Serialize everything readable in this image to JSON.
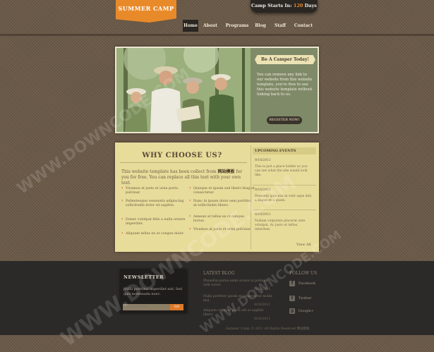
{
  "header": {
    "logo": "SUMMER CAMP",
    "countdown_prefix": "Camp Starts In:",
    "countdown_number": "120",
    "countdown_suffix": "Days"
  },
  "nav": {
    "items": [
      {
        "label": "Home",
        "active": true
      },
      {
        "label": "About",
        "active": false
      },
      {
        "label": "Programs",
        "active": false
      },
      {
        "label": "Blog",
        "active": false
      },
      {
        "label": "Staff",
        "active": false
      },
      {
        "label": "Contact",
        "active": false
      }
    ]
  },
  "hero": {
    "ribbon": "Be A Camper Today!",
    "description": "You can remove any link to our website from this website template, you're free to use this website template without linking back to us.",
    "button": "REGISTER NOW!"
  },
  "why": {
    "title": "WHY CHOOSE US?",
    "intro_before": "This website template has been collect from",
    "intro_link": "网站模板",
    "intro_after": "for you for free. You can replace all this text with your own text.",
    "bullets": [
      "Vivamus at justo et urna porta pulvinar.",
      "Pellentesque venenatis adipiscing sollicitudin dolor sit sagittis.",
      "Donec volutpat felis a nulla ornare imperdiet.",
      "Aliquam tellus ex at congue dolor.",
      "Quisque et ipsum sed libero feugiat consectetur.",
      "Nunc in ipsum dolor sem porttitor at sollicitudin libero.",
      "Aenean at tellus ex et congue luctus.",
      "Vivamus at justo et urna pulvinar."
    ]
  },
  "events": {
    "title": "UPCOMING EVENTS",
    "items": [
      {
        "date": "8/16/2011",
        "text": "This is just a place holder so you can see what the site would look like."
      },
      {
        "date": "8/16/2011",
        "text": "Praesent quis nisl in velit aque deli a augue et a quam."
      },
      {
        "date": "8/16/2011",
        "text": "Nullam vulputate placerat ante volutpat. Ac justo ut tellus, interdum."
      }
    ],
    "view_all": "View All"
  },
  "footer": {
    "newsletter_title": "NEWSLETTER",
    "newsletter_text": "Nulla porttitor imperdiet nisl. Sed quis malesuada nunc.",
    "email_placeholder": "Email Address",
    "go": "GO",
    "latest_title": "LATEST BLOG",
    "posts": [
      {
        "text": "Phasellus purus enim ornare ut pretium velit tortor.",
        "date": "8/16/2011"
      },
      {
        "text": "Nulla porttitor ipsum et consectetur mollis nisl.",
        "date": "8/16/2011"
      },
      {
        "text": "Aliquam volutpat porta elit at sagittis libero.",
        "date": "8/16/2011"
      }
    ],
    "follow_title": "FOLLOW US",
    "social": [
      {
        "icon": "facebook-icon",
        "glyph": "f",
        "label": "Facebook"
      },
      {
        "icon": "twitter-icon",
        "glyph": "t",
        "label": "Twitter"
      },
      {
        "icon": "googleplus-icon",
        "glyph": "g",
        "label": "Google+"
      }
    ],
    "copyright": "Summer Camp © 2011 All Rights Reserved 网站模板"
  },
  "watermark": "WWW.DOWNCODE.COM",
  "colors": {
    "accent": "#e98a2a",
    "panel": "#e8dc9b",
    "footer": "#2c2a28"
  }
}
